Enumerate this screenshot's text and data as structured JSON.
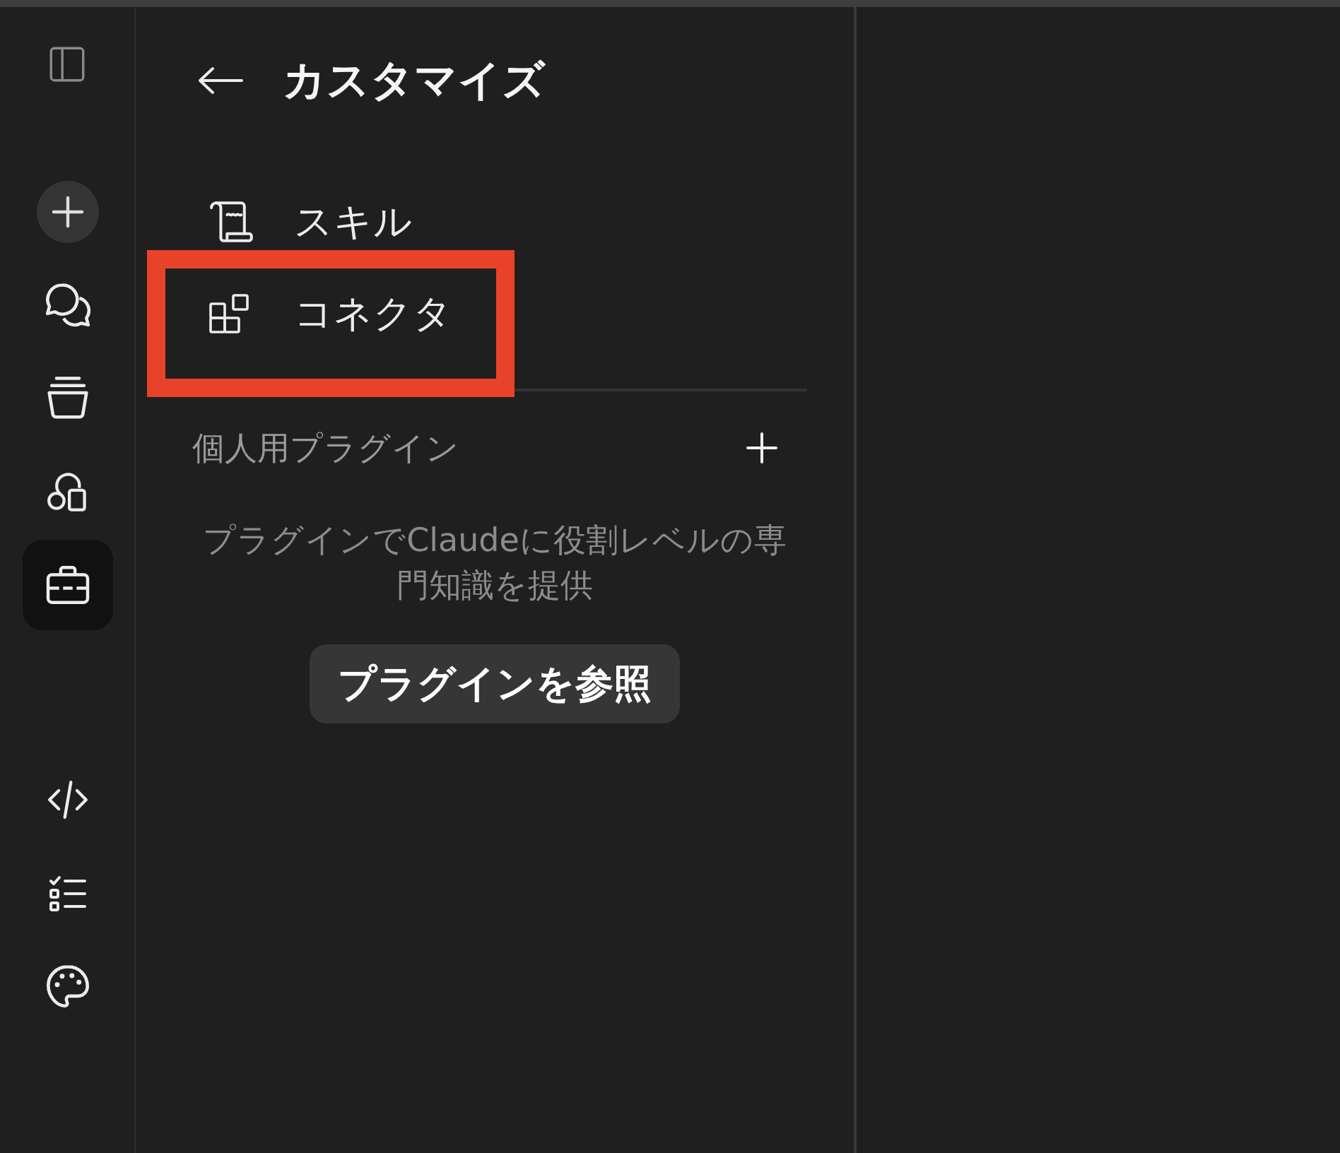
{
  "rail": {
    "nav": [
      {
        "selected": false
      },
      {
        "selected": false
      },
      {
        "selected": false
      },
      {
        "selected": true
      }
    ],
    "tools": [
      {
        "selected": false
      },
      {
        "selected": false
      },
      {
        "selected": false
      }
    ]
  },
  "panel": {
    "title": "カスタマイズ",
    "items": [
      {
        "label": "スキル",
        "selected": false,
        "highlighted": false
      },
      {
        "label": "コネクタ",
        "selected": false,
        "highlighted": true
      }
    ],
    "plugins": {
      "title": "個人用プラグイン",
      "description": "プラグインでClaudeに役割レベルの専門知識を提供",
      "button": "プラグインを参照"
    }
  }
}
